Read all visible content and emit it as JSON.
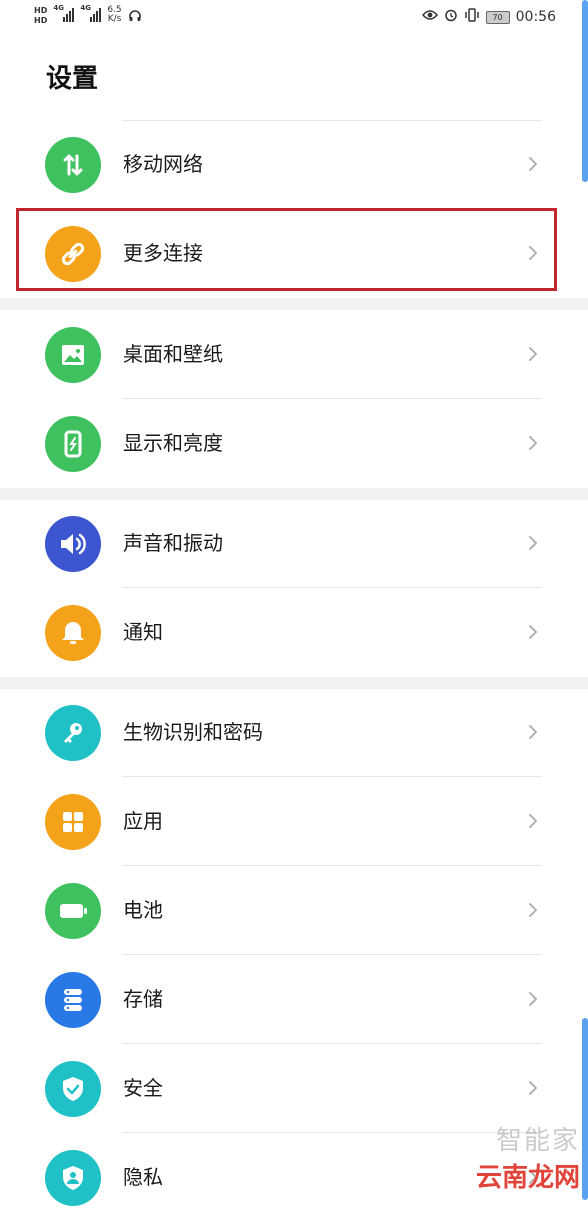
{
  "status_bar": {
    "hd1": "HD",
    "hd2": "HD",
    "net1": "4G",
    "net2": "4G",
    "speed": "6.5",
    "speed_unit": "K/s",
    "battery": "70",
    "time": "00:56"
  },
  "title": "设置",
  "items": [
    {
      "label": "移动网络",
      "icon": "swap-arrows-icon",
      "color": "#3fc15f"
    },
    {
      "label": "更多连接",
      "icon": "link-icon",
      "color": "#f4a21a"
    },
    {
      "label": "桌面和壁纸",
      "icon": "picture-icon",
      "color": "#3fc15f"
    },
    {
      "label": "显示和亮度",
      "icon": "phone-brightness-icon",
      "color": "#3fc15f"
    },
    {
      "label": "声音和振动",
      "icon": "speaker-icon",
      "color": "#3c56d0"
    },
    {
      "label": "通知",
      "icon": "bell-icon",
      "color": "#f4a21a"
    },
    {
      "label": "生物识别和密码",
      "icon": "key-icon",
      "color": "#1fc0c6"
    },
    {
      "label": "应用",
      "icon": "apps-grid-icon",
      "color": "#f4a21a"
    },
    {
      "label": "电池",
      "icon": "battery-icon",
      "color": "#3fc15f"
    },
    {
      "label": "存储",
      "icon": "storage-icon",
      "color": "#2878e6"
    },
    {
      "label": "安全",
      "icon": "shield-check-icon",
      "color": "#1fc0c6"
    },
    {
      "label": "隐私",
      "icon": "privacy-shield-icon",
      "color": "#1fc0c6"
    }
  ],
  "watermark": {
    "line1": "智能家",
    "line2": "云南龙网"
  }
}
